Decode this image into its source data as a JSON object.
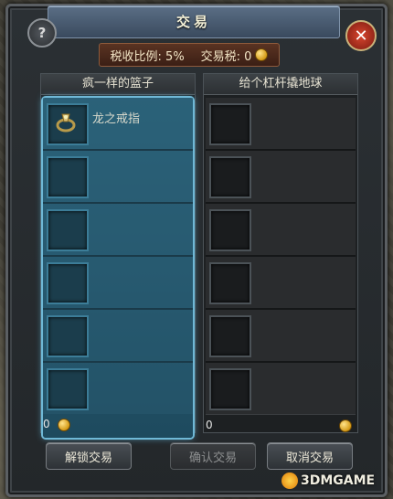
{
  "window": {
    "title": "交易"
  },
  "tax": {
    "rate_label": "税收比例: 5%",
    "fee_label": "交易税: 0"
  },
  "panels": {
    "left": {
      "header": "疯一样的篮子",
      "items": [
        {
          "name": "龙之戒指"
        }
      ],
      "money": "0"
    },
    "right": {
      "header": "给个杠杆撬地球",
      "money": "0"
    }
  },
  "buttons": {
    "unlock": "解锁交易",
    "confirm": "确认交易",
    "cancel": "取消交易"
  },
  "icons": {
    "help": "help-icon",
    "close": "close-icon",
    "coin": "coin-icon",
    "ring": "ring-icon"
  },
  "colors": {
    "accent": "#6fb8d6",
    "close": "#d9462f",
    "gold": "#d49a16"
  },
  "watermark": {
    "text": "3DMGAME"
  }
}
